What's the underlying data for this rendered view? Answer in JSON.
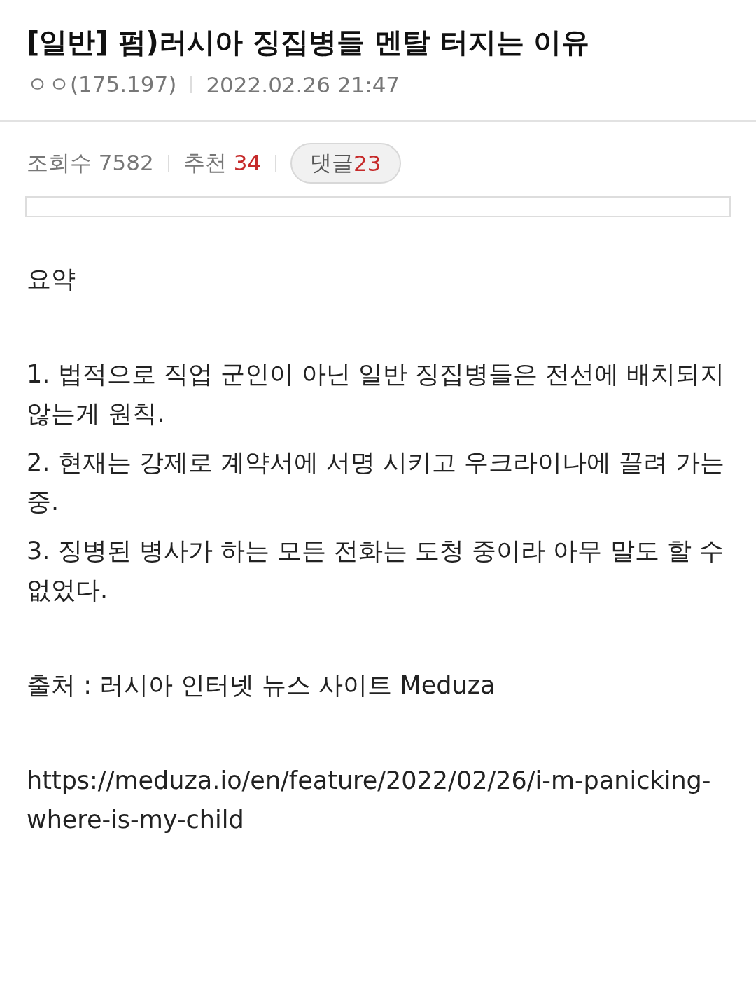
{
  "post": {
    "category": "[일반]",
    "title": "펌)러시아 징집병들 멘탈 터지는 이유",
    "author": "ㅇㅇ",
    "ip": "(175.197)",
    "date": "2022.02.26 21:47"
  },
  "stats": {
    "views_label": "조회수",
    "views": "7582",
    "recommend_label": "추천",
    "recommend": "34",
    "comments_label": "댓글",
    "comments": "23"
  },
  "body": [
    [
      "요약"
    ],
    [
      "1. 법적으로 직업 군인이 아닌 일반 징집병들은 전선에 배치되지 않는게 원칙.",
      "2. 현재는 강제로 계약서에 서명 시키고 우크라이나에 끌려 가는 중.",
      "3. 징병된 병사가 하는 모든 전화는 도청 중이라 아무 말도 할 수 없었다."
    ],
    [
      "출처 : 러시아 인터넷 뉴스 사이트 Meduza"
    ],
    [
      "https://meduza.io/en/feature/2022/02/26/i-m-panicking-where-is-my-child"
    ]
  ]
}
